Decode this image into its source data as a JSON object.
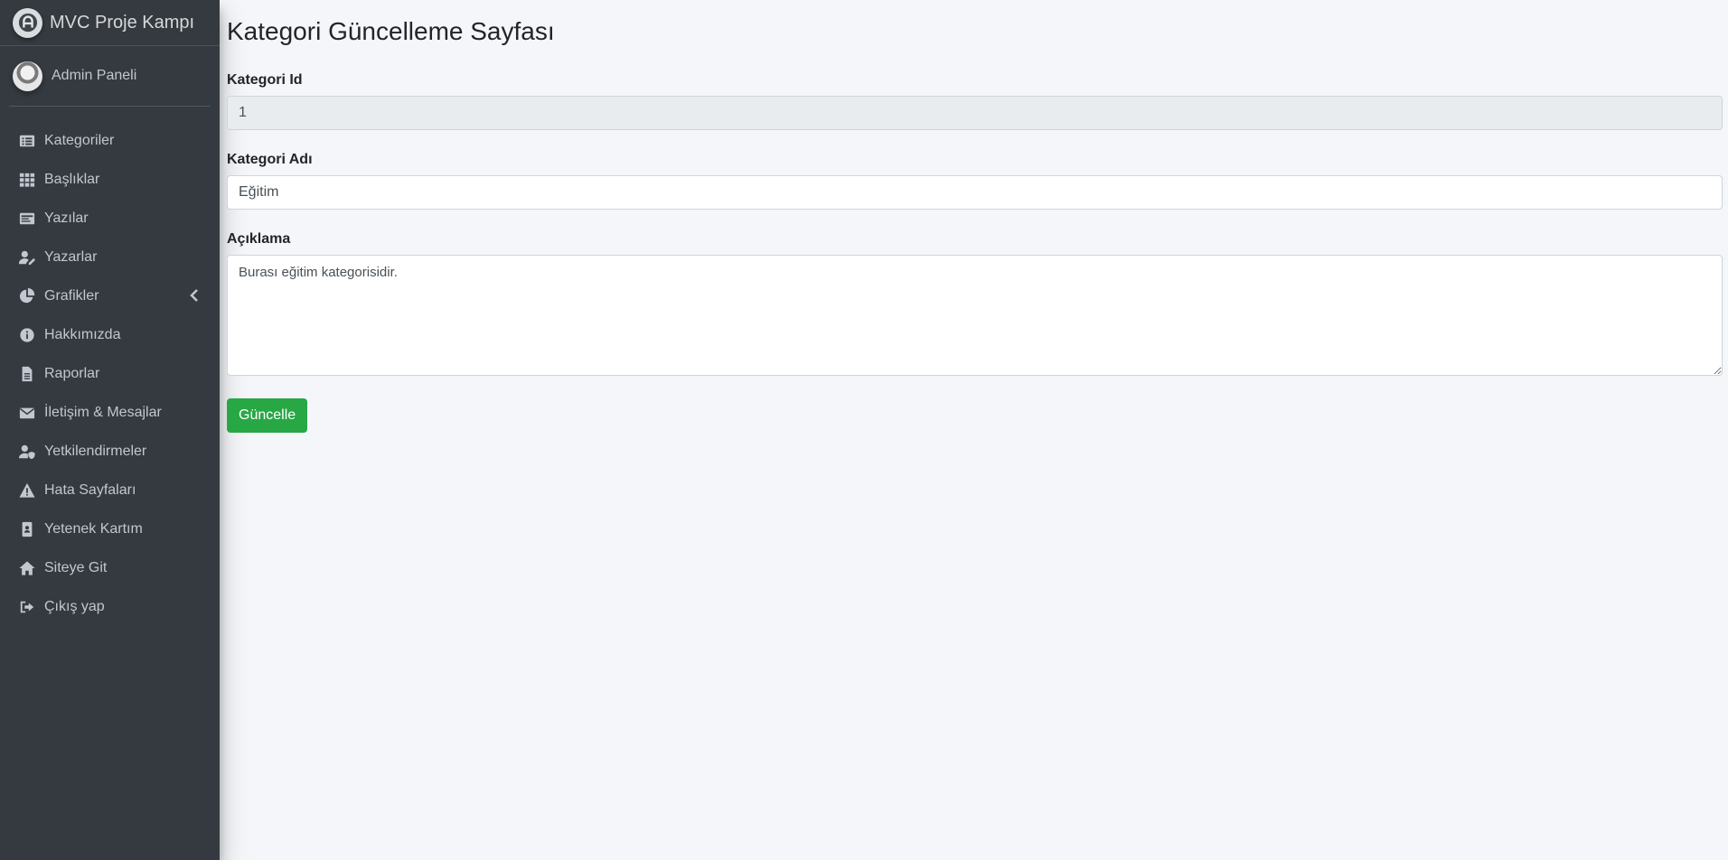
{
  "brand": {
    "title": "MVC Proje Kampı",
    "logo_icon": "adminlte-logo-icon"
  },
  "user": {
    "name": "Admin Paneli",
    "avatar_icon": "user-avatar"
  },
  "sidebar": {
    "items": [
      {
        "label": "Kategoriler",
        "icon": "list-icon"
      },
      {
        "label": "Başlıklar",
        "icon": "grid-icon"
      },
      {
        "label": "Yazılar",
        "icon": "card-icon"
      },
      {
        "label": "Yazarlar",
        "icon": "user-edit-icon"
      },
      {
        "label": "Grafikler",
        "icon": "pie-chart-icon"
      },
      {
        "label": "Hakkımızda",
        "icon": "info-icon"
      },
      {
        "label": "Raporlar",
        "icon": "file-icon"
      },
      {
        "label": "İletişim & Mesajlar",
        "icon": "envelope-icon"
      },
      {
        "label": "Yetkilendirmeler",
        "icon": "user-shield-icon"
      },
      {
        "label": "Hata Sayfaları",
        "icon": "warning-icon"
      },
      {
        "label": "Yetenek Kartım",
        "icon": "id-badge-icon"
      },
      {
        "label": "Siteye Git",
        "icon": "home-icon"
      },
      {
        "label": "Çıkış yap",
        "icon": "sign-out-icon"
      }
    ]
  },
  "page": {
    "title": "Kategori Güncelleme Sayfası",
    "form": {
      "id_label": "Kategori Id",
      "id_value": "1",
      "name_label": "Kategori Adı",
      "name_value": "Eğitim",
      "description_label": "Açıklama",
      "description_value": "Burası eğitim kategorisidir.",
      "submit_label": "Güncelle"
    }
  },
  "colors": {
    "sidebar_bg": "#343a40",
    "content_bg": "#f4f6f9",
    "button_success": "#28a745"
  }
}
